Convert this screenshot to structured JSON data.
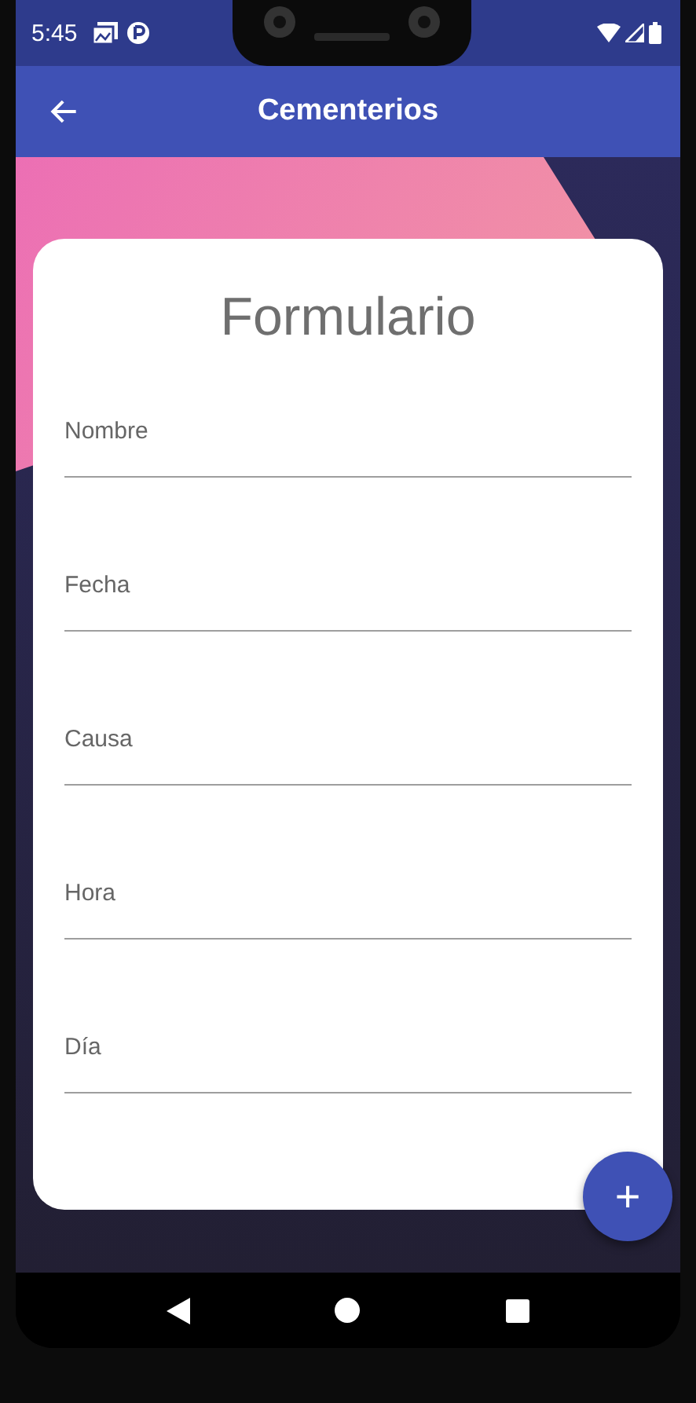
{
  "status_bar": {
    "time": "5:45"
  },
  "app_bar": {
    "title": "Cementerios"
  },
  "form": {
    "title": "Formulario",
    "fields": [
      {
        "placeholder": "Nombre"
      },
      {
        "placeholder": "Fecha"
      },
      {
        "placeholder": "Causa"
      },
      {
        "placeholder": "Hora"
      },
      {
        "placeholder": "Día"
      }
    ]
  },
  "fab": {
    "label": "+"
  }
}
